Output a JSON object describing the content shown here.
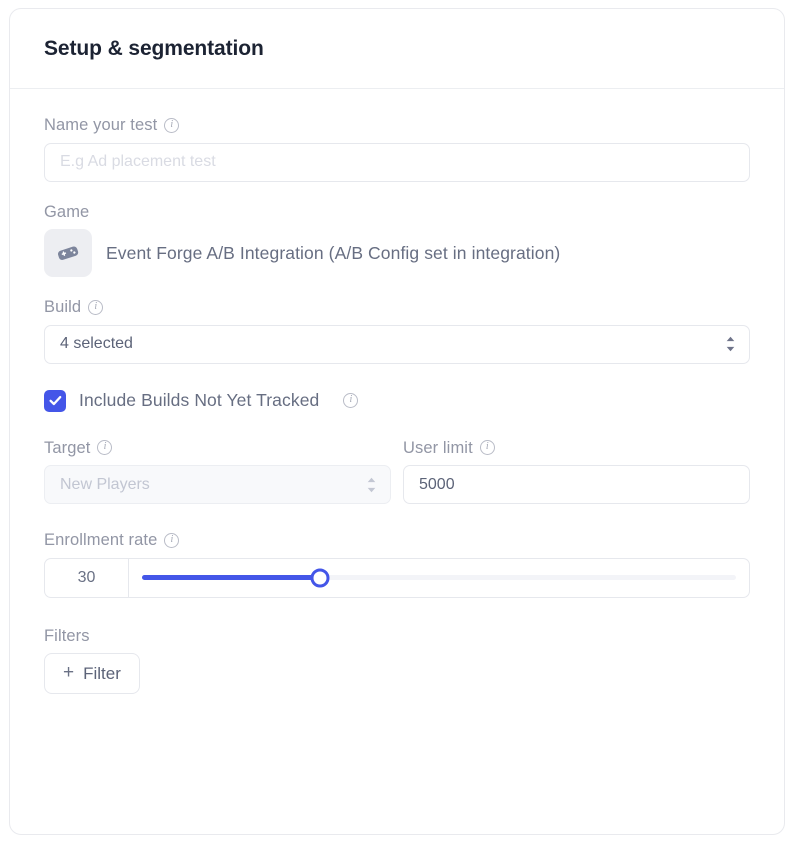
{
  "card": {
    "title": "Setup & segmentation"
  },
  "fields": {
    "name": {
      "label": "Name your test",
      "info_icon": "info-circle-icon",
      "value": "",
      "placeholder": "E.g Ad placement test"
    },
    "game": {
      "label": "Game",
      "icon": "gamepad-icon",
      "name": "Event Forge A/B Integration (A/B Config set in integration)"
    },
    "build": {
      "label": "Build",
      "info_icon": "info-circle-icon",
      "selected": "4 selected",
      "chevron": "chevron-up-down-icon"
    },
    "include_builds": {
      "label": "Include Builds Not Yet Tracked",
      "checked": true,
      "check_icon": "check-icon",
      "info_icon": "info-circle-icon"
    },
    "target": {
      "label": "Target",
      "info_icon": "info-circle-icon",
      "selected": "New Players",
      "disabled": true,
      "chevron": "chevron-up-down-icon"
    },
    "user_limit": {
      "label": "User limit",
      "info_icon": "info-circle-icon",
      "value": "5000"
    },
    "enrollment_rate": {
      "label": "Enrollment rate",
      "info_icon": "info-circle-icon",
      "value": "30",
      "min": 0,
      "max": 100,
      "percent": 30
    },
    "filters": {
      "label": "Filters",
      "add_button": "Filter",
      "add_icon": "plus-icon"
    }
  },
  "colors": {
    "accent": "#4456e8",
    "label": "#9296a5",
    "text": "#676e82",
    "border": "#e6e8ed",
    "card_border": "#e9eaee",
    "title": "#1c2333",
    "placeholder": "#d9dbe3",
    "icon_bg": "#edeef2",
    "disabled_bg": "#f8f9fb"
  }
}
